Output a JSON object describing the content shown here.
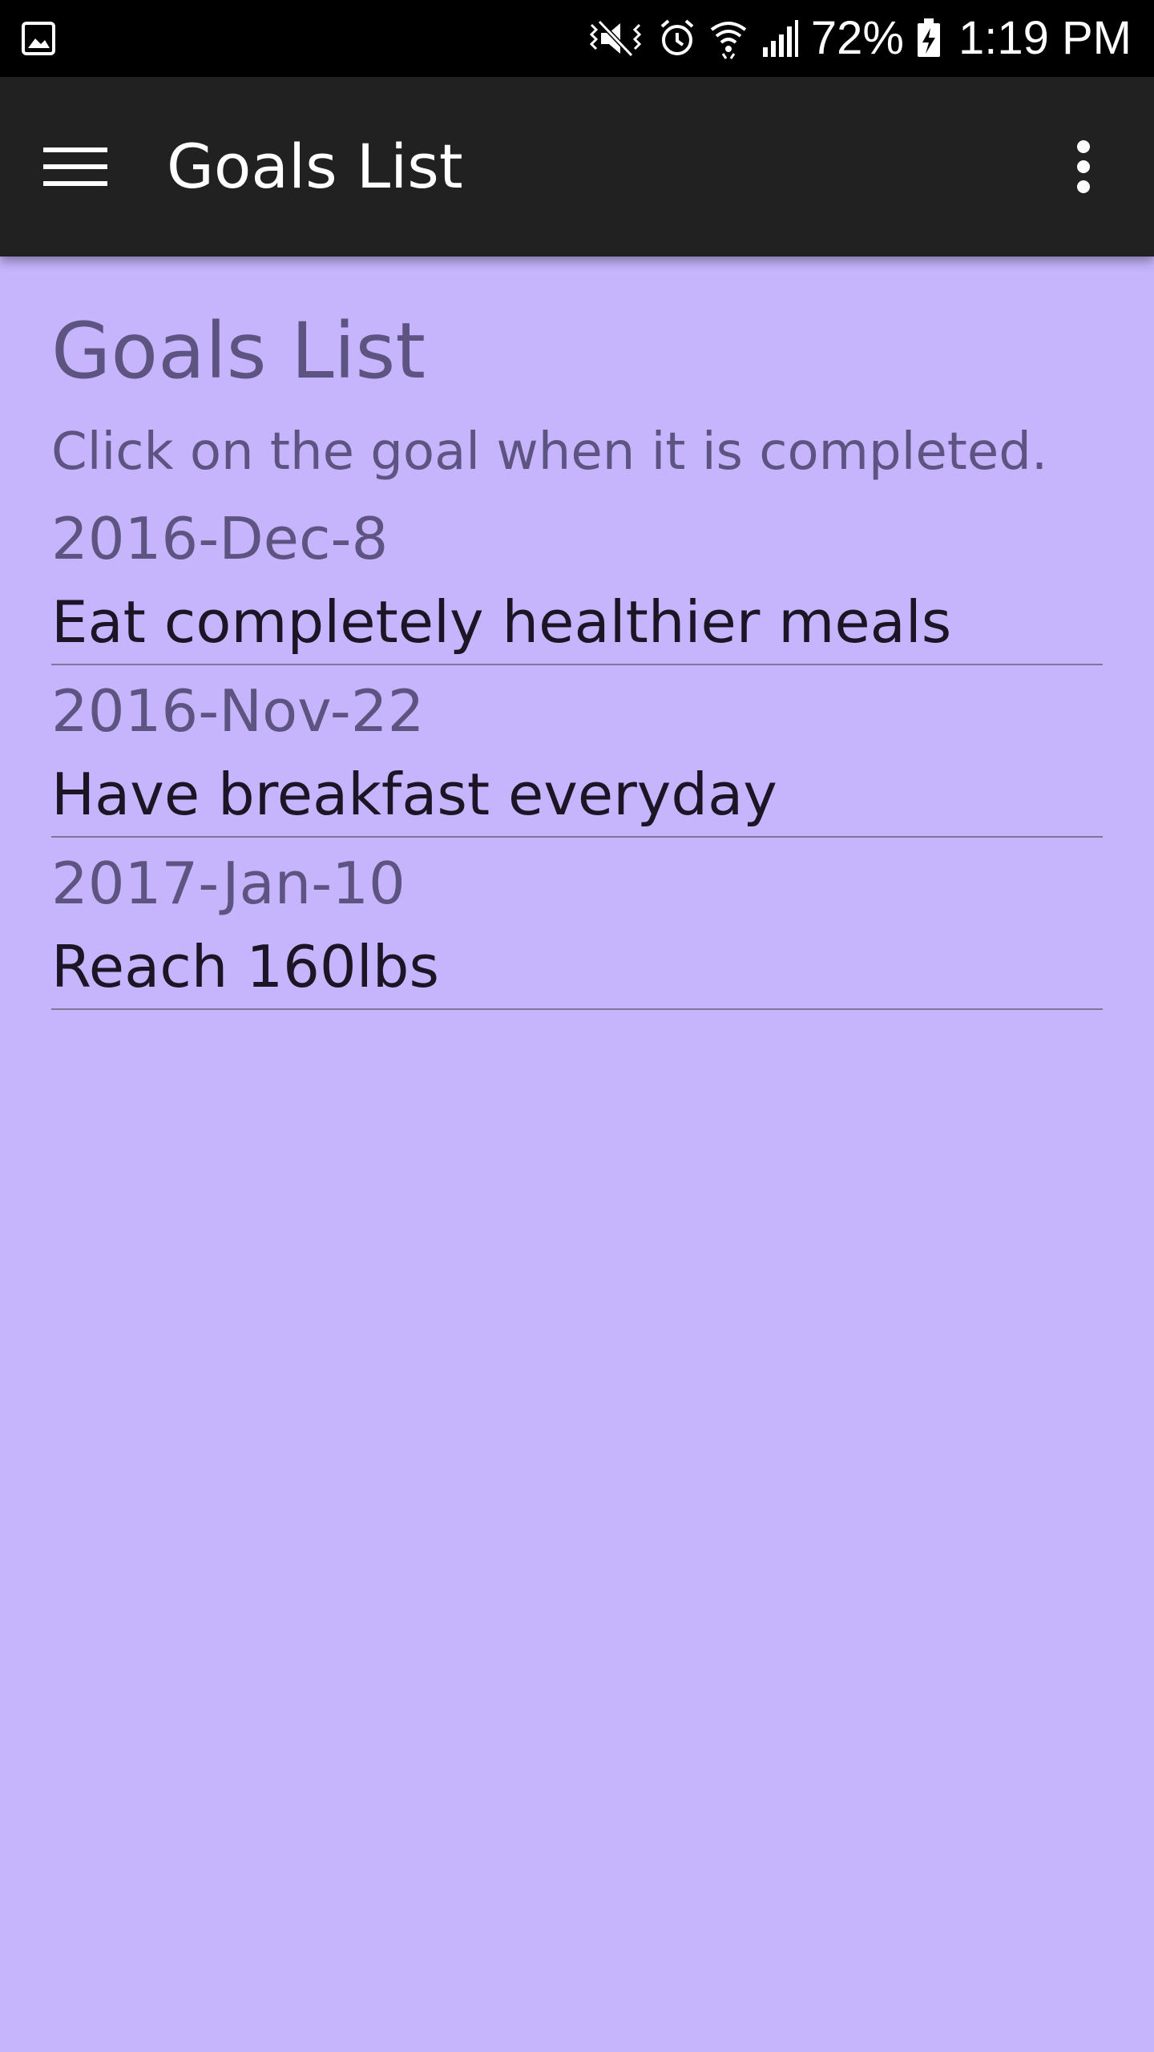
{
  "status_bar": {
    "left_icon": "image-notification-icon",
    "icons": [
      "mute-vibrate-icon",
      "alarm-icon",
      "wifi-icon",
      "signal-icon"
    ],
    "battery_percent": "72%",
    "battery_icon": "battery-charging-icon",
    "time": "1:19 PM"
  },
  "app_bar": {
    "title": "Goals List",
    "menu_icon": "hamburger-menu-icon",
    "overflow_icon": "more-vert-icon"
  },
  "page": {
    "title": "Goals List",
    "instruction": "Click on the goal when it is completed."
  },
  "goals": [
    {
      "date": "2016-Dec-8",
      "text": "Eat completely healthier meals"
    },
    {
      "date": "2016-Nov-22",
      "text": "Have breakfast everyday"
    },
    {
      "date": "2017-Jan-10",
      "text": "Reach 160lbs"
    }
  ],
  "colors": {
    "background": "#c6b4fd",
    "app_bar": "#212121",
    "status_bar": "#000000",
    "muted_text": "#5e5482",
    "goal_text": "#1b1526"
  }
}
